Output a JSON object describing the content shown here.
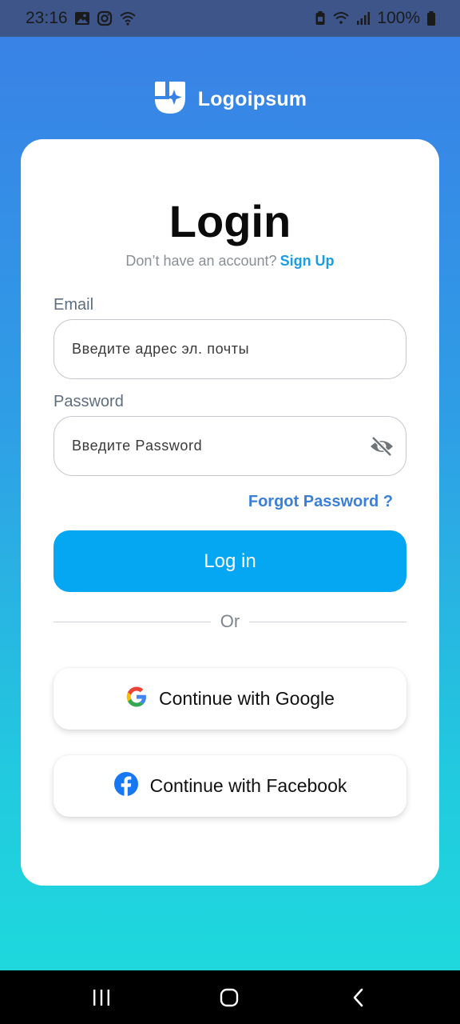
{
  "status_bar": {
    "time": "23:16",
    "battery": "100%",
    "left_icons": [
      "gallery-icon",
      "instagram-icon",
      "wifi-icon"
    ],
    "right_icons": [
      "battery-saver-icon",
      "wifi-signal-icon",
      "cell-signal-icon",
      "battery-icon"
    ]
  },
  "brand": {
    "name": "Logoipsum",
    "logo_icon": "logo-icon"
  },
  "login": {
    "title": "Login",
    "no_account_text": "Don’t have an account?",
    "signup_link": "Sign Up",
    "email_label": "Email",
    "email_placeholder": "Введите адрес эл. почты",
    "password_label": "Password",
    "password_placeholder": "Введите Password",
    "forgot_password": "Forgot Password ?",
    "login_button": "Log in",
    "divider_text": "Or",
    "google_button": "Continue with Google",
    "facebook_button": "Continue with Facebook"
  },
  "colors": {
    "gradient_top": "#3a7fe6",
    "gradient_bottom": "#1ddcdc",
    "primary_button": "#05a6f2",
    "link": "#1b9de3",
    "forgot_link": "#3a7fd8",
    "status_bar": "#3d5588"
  },
  "nav_bar": {
    "icons": [
      "recent-apps-icon",
      "home-icon",
      "back-icon"
    ]
  }
}
